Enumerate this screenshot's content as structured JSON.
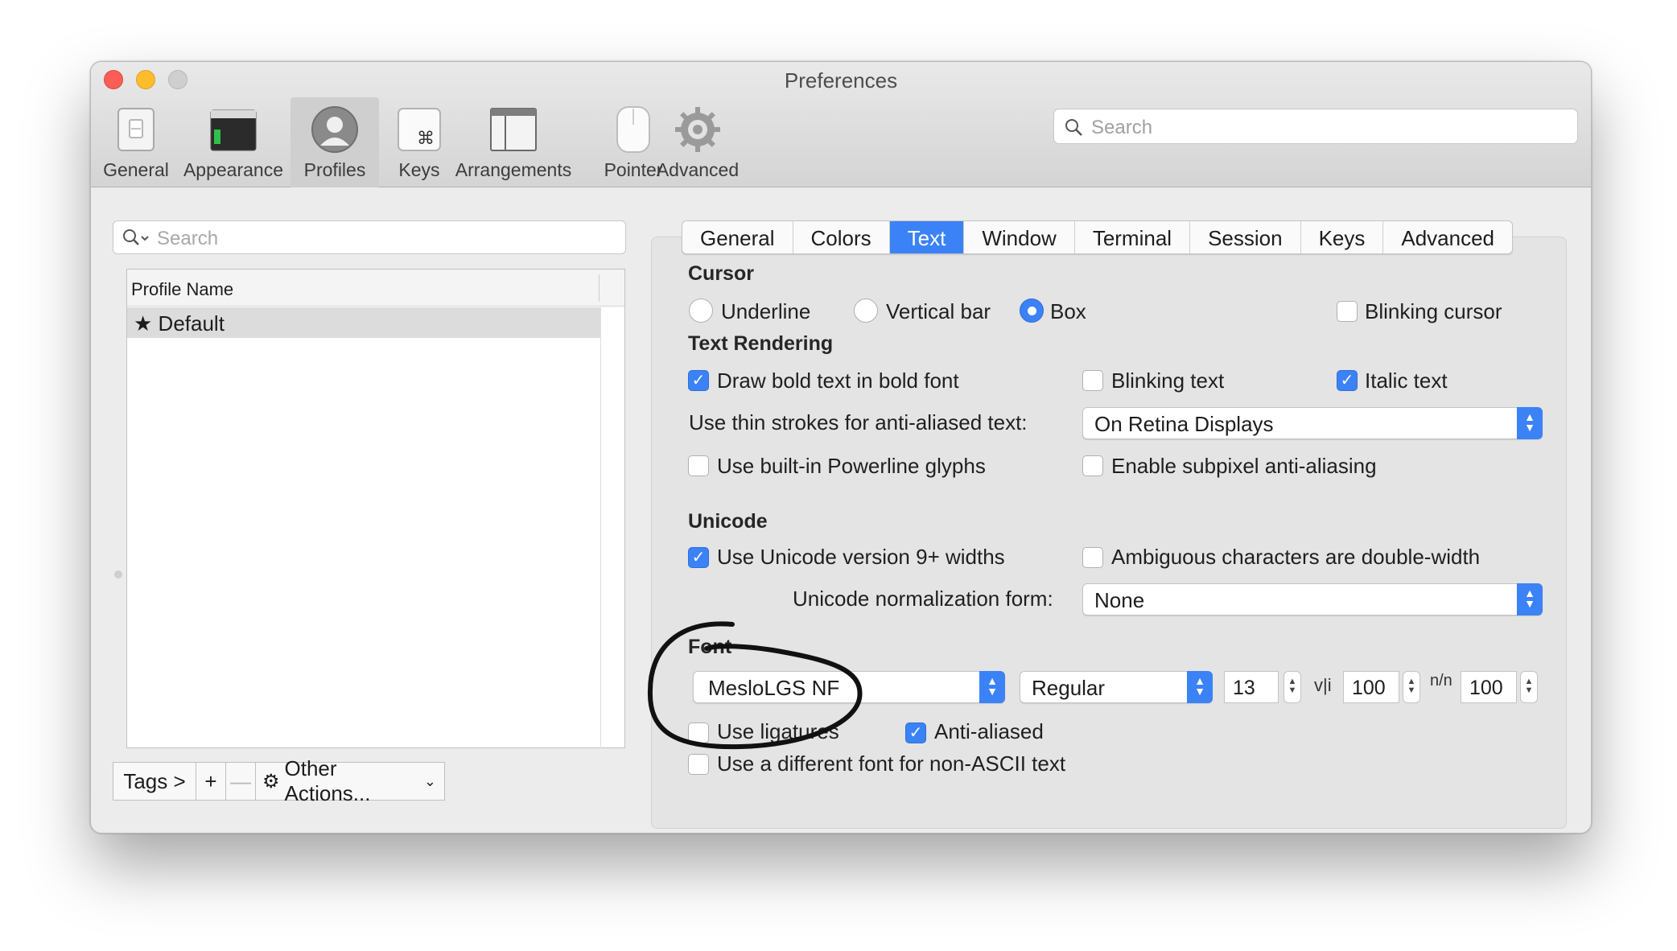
{
  "window": {
    "title": "Preferences"
  },
  "toolbar": {
    "items": [
      {
        "label": "General",
        "icon": "general-switch-icon"
      },
      {
        "label": "Appearance",
        "icon": "appearance-terminal-icon"
      },
      {
        "label": "Profiles",
        "icon": "profiles-person-icon",
        "active": true
      },
      {
        "label": "Keys",
        "icon": "keys-command-icon"
      },
      {
        "label": "Arrangements",
        "icon": "arrangements-window-icon"
      },
      {
        "label": "Pointer",
        "icon": "pointer-mouse-icon"
      },
      {
        "label": "Advanced",
        "icon": "advanced-gear-icon"
      }
    ],
    "search_placeholder": "Search"
  },
  "profiles": {
    "search_placeholder": "Search",
    "column_header": "Profile Name",
    "rows": [
      {
        "name": "Default",
        "is_default": true
      }
    ],
    "bottom": {
      "tags_label": "Tags >",
      "add_label": "+",
      "remove_label": "—",
      "other_actions_label": "Other Actions..."
    }
  },
  "tabs": [
    "General",
    "Colors",
    "Text",
    "Window",
    "Terminal",
    "Session",
    "Keys",
    "Advanced"
  ],
  "active_tab": "Text",
  "cursor": {
    "heading": "Cursor",
    "options": [
      "Underline",
      "Vertical bar",
      "Box"
    ],
    "selected": "Box",
    "blinking_label": "Blinking cursor",
    "blinking": false
  },
  "text_rendering": {
    "heading": "Text Rendering",
    "bold_label": "Draw bold text in bold font",
    "bold": true,
    "blinking_text_label": "Blinking text",
    "blinking_text": false,
    "italic_label": "Italic text",
    "italic": true,
    "thin_strokes_label": "Use thin strokes for anti-aliased text:",
    "thin_strokes_value": "On Retina Displays",
    "powerline_label": "Use built-in Powerline glyphs",
    "powerline": false,
    "subpixel_label": "Enable subpixel anti-aliasing",
    "subpixel": false
  },
  "unicode": {
    "heading": "Unicode",
    "v9_label": "Use Unicode version 9+ widths",
    "v9": true,
    "ambiguous_label": "Ambiguous characters are double-width",
    "ambiguous": false,
    "normalization_label": "Unicode normalization form:",
    "normalization_value": "None"
  },
  "font": {
    "heading": "Font",
    "family": "MesloLGS NF",
    "style": "Regular",
    "size": "13",
    "h_spacing_icon": "v|i",
    "h_spacing": "100",
    "v_spacing_icon": "n/n",
    "v_spacing": "100",
    "ligatures_label": "Use ligatures",
    "ligatures": false,
    "antialiased_label": "Anti-aliased",
    "antialiased": true,
    "non_ascii_label": "Use a different font for non-ASCII text",
    "non_ascii": false
  },
  "colors": {
    "accent": "#3b82f6",
    "annotation": "#111111"
  }
}
